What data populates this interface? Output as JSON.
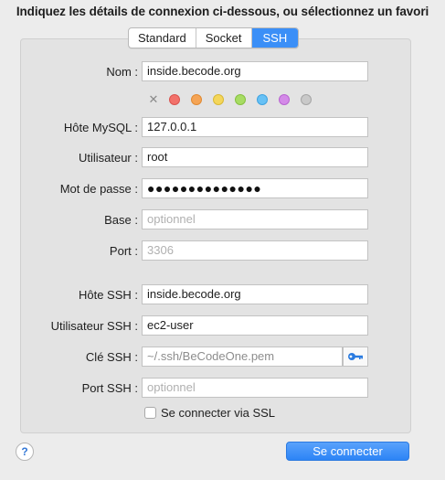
{
  "title": "Indiquez les détails de connexion ci-dessous, ou sélectionnez un favori",
  "tabs": [
    {
      "label": "Standard"
    },
    {
      "label": "Socket"
    },
    {
      "label": "SSH"
    }
  ],
  "active_tab": "SSH",
  "form": {
    "name": {
      "label": "Nom :",
      "value": "inside.becode.org"
    },
    "host": {
      "label": "Hôte MySQL :",
      "value": "127.0.0.1"
    },
    "user": {
      "label": "Utilisateur :",
      "value": "root"
    },
    "password": {
      "label": "Mot de passe :",
      "value": "●●●●●●●●●●●●●●"
    },
    "database": {
      "label": "Base :",
      "placeholder": "optionnel"
    },
    "port": {
      "label": "Port :",
      "placeholder": "3306"
    },
    "ssh_host": {
      "label": "Hôte SSH :",
      "value": "inside.becode.org"
    },
    "ssh_user": {
      "label": "Utilisateur SSH :",
      "value": "ec2-user"
    },
    "ssh_key": {
      "label": "Clé SSH :",
      "value": "~/.ssh/BeCodeOne.pem"
    },
    "ssh_port": {
      "label": "Port SSH :",
      "placeholder": "optionnel"
    }
  },
  "color_tags": [
    {
      "name": "red",
      "fill": "#f2716a",
      "border": "#d9534f"
    },
    {
      "name": "orange",
      "fill": "#f5a455",
      "border": "#e08a33"
    },
    {
      "name": "yellow",
      "fill": "#f4d65a",
      "border": "#d9b935"
    },
    {
      "name": "green",
      "fill": "#a7dc63",
      "border": "#86c040"
    },
    {
      "name": "blue",
      "fill": "#67c1f5",
      "border": "#3fa3e0"
    },
    {
      "name": "purple",
      "fill": "#d48ae8",
      "border": "#b865d0"
    },
    {
      "name": "gray",
      "fill": "#c9c9c9",
      "border": "#a5a5a5"
    }
  ],
  "ssl_checkbox": {
    "label": "Se connecter via SSL",
    "checked": false
  },
  "connect_button": "Se connecter",
  "help_button": "?",
  "icons": {
    "color_clear": "x-mark-icon",
    "ssh_key": "key-icon"
  },
  "accent_color": "#3b8ff7"
}
